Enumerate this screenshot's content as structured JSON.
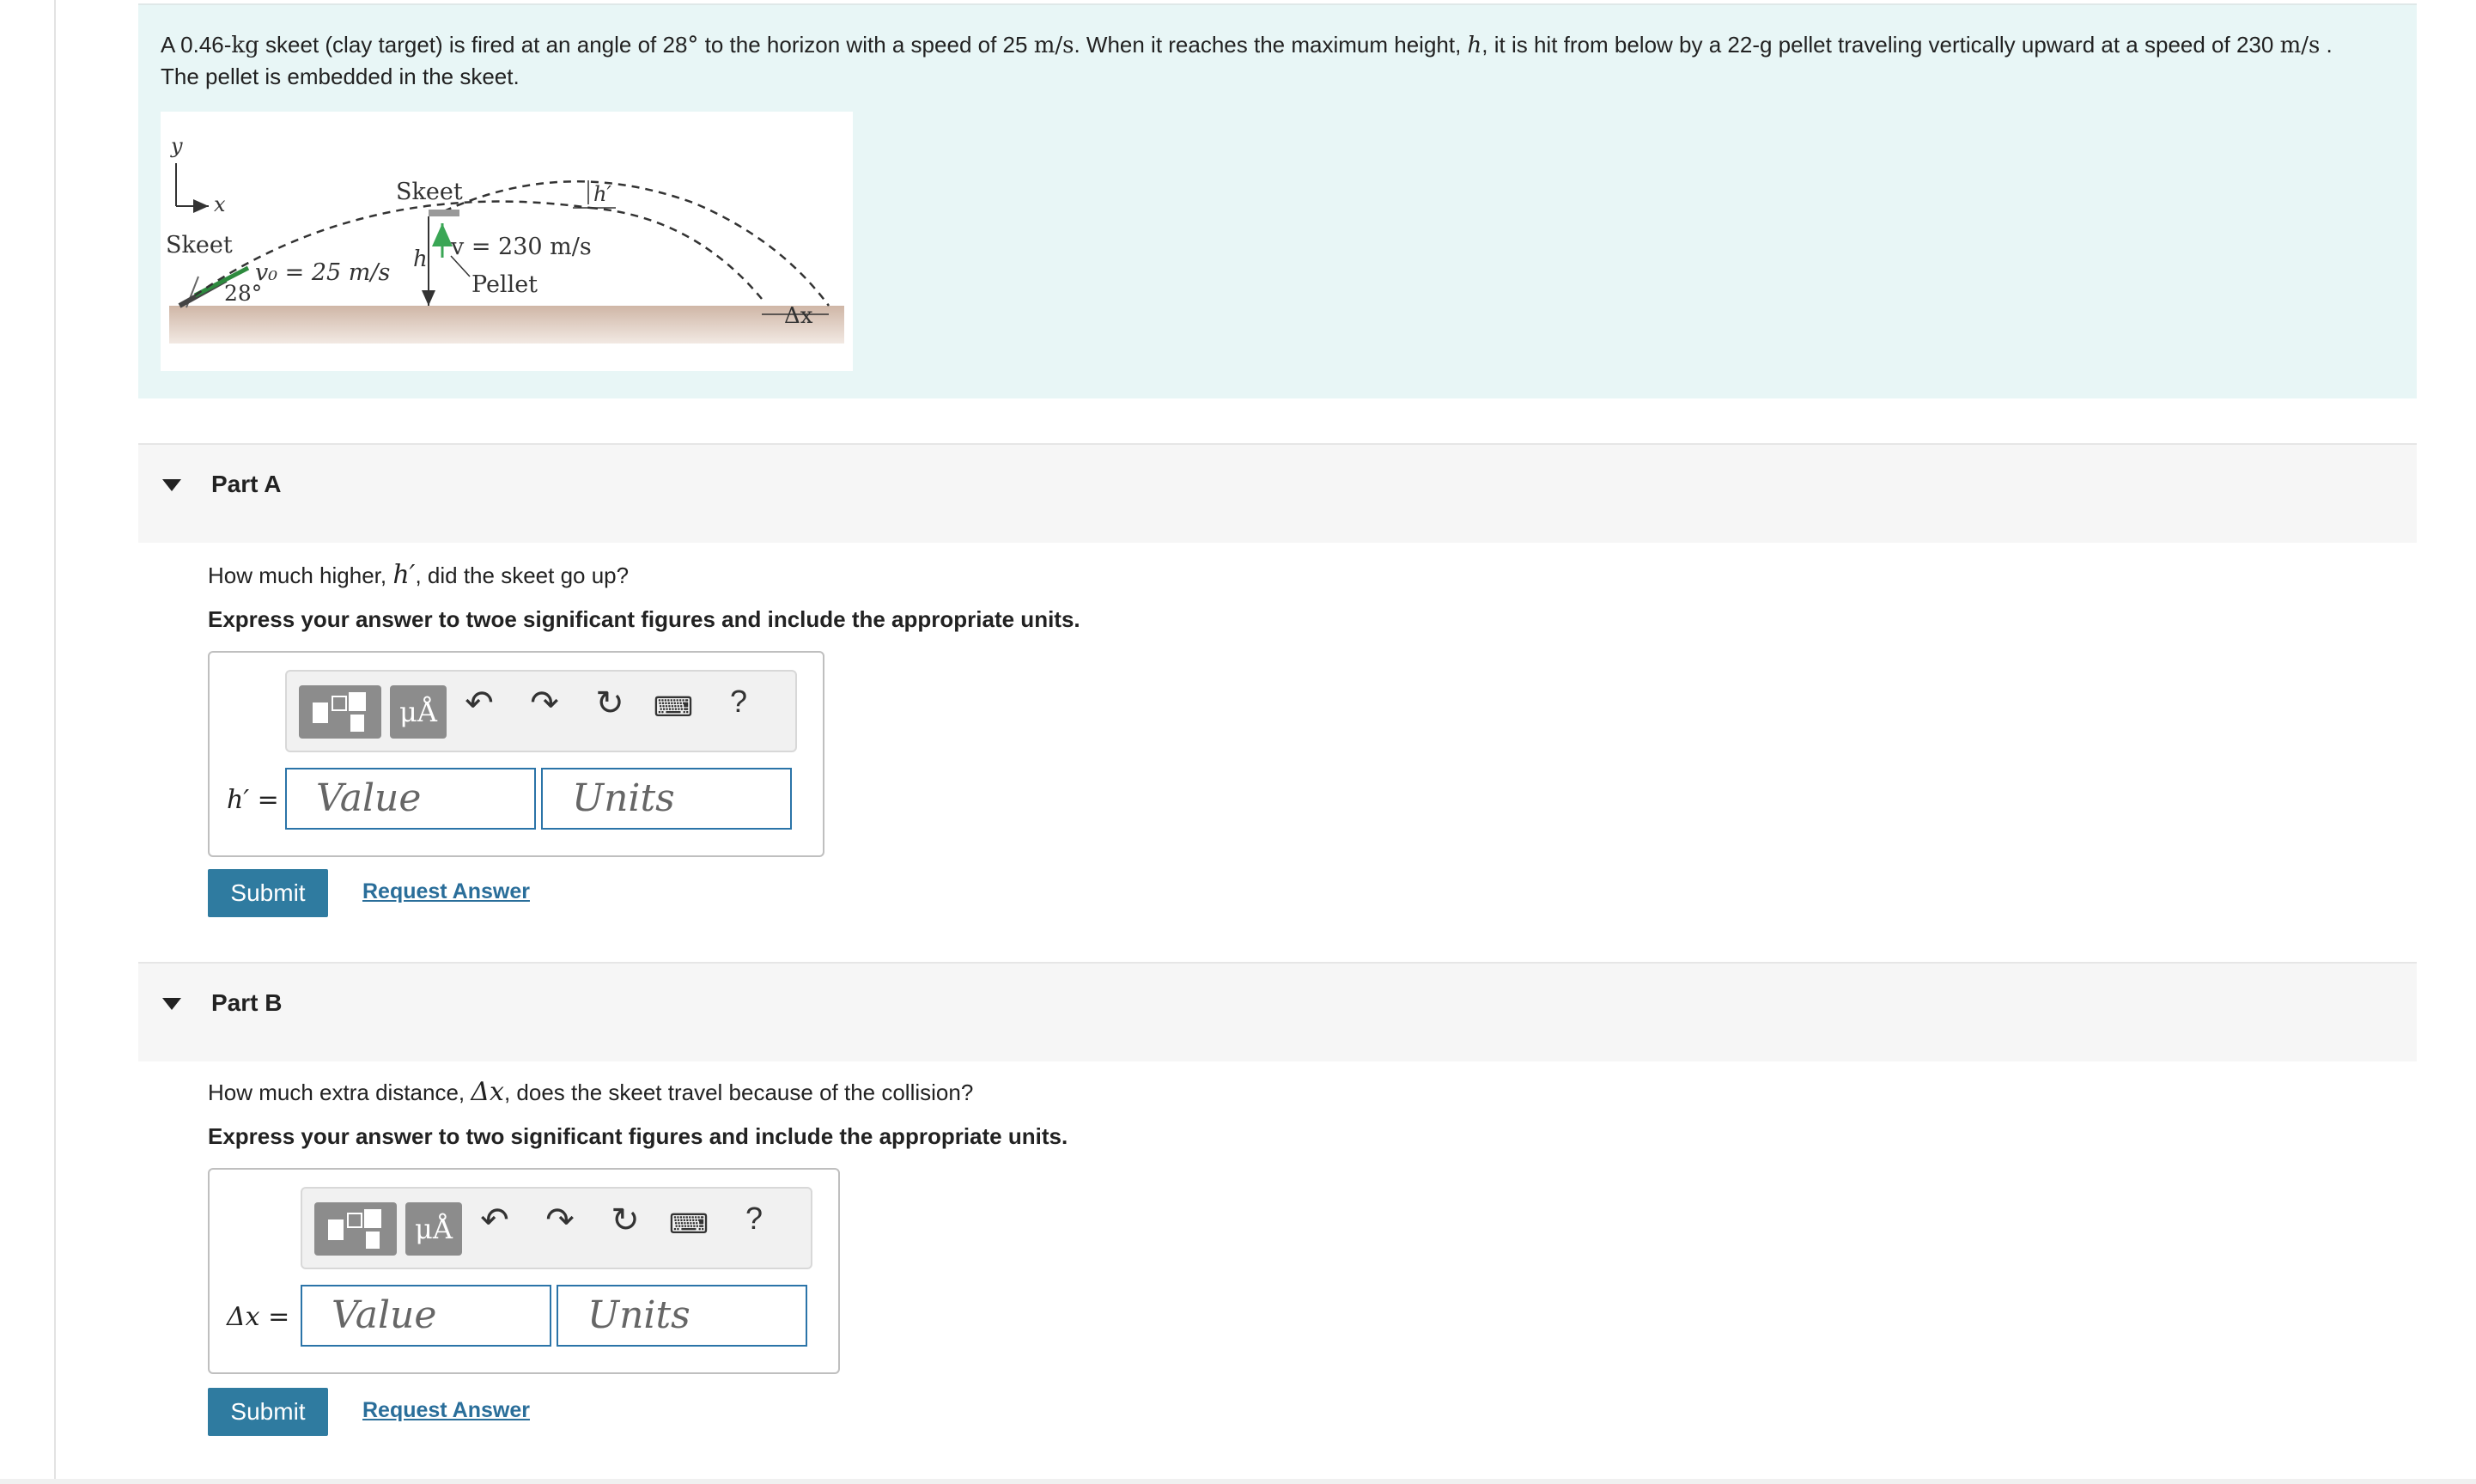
{
  "problem": {
    "text_1": "A 0.46-",
    "kg": "kg",
    "text_2": " skeet (clay target) is fired at an angle of 28",
    "deg": "°",
    "text_3": " to the horizon with a speed of 25 ",
    "ms": "m/s",
    "text_4": ". When it reaches the maximum height, ",
    "h": "h",
    "text_5": ", it is hit from below by a 22-g pellet traveling vertically upward at a speed of 230 ",
    "ms2": "m/s",
    "text_6": " . The pellet is embedded in the skeet."
  },
  "figure": {
    "axis_y": "y",
    "axis_x": "x",
    "skeet_left": "Skeet",
    "skeet_top": "Skeet",
    "v0_label": "v₀ = 25 m/s",
    "angle_label": "28°",
    "h_label": "h",
    "hprime_label": "h′",
    "v_label": "v = 230 m/s",
    "pellet_label": "Pellet",
    "dx_label": "Δx"
  },
  "colors": {
    "accent": "#2f7ba0",
    "field_border": "#2b74a8",
    "problem_bg": "#e8f6f6",
    "link": "#2a6e9a",
    "pellet_arrow": "#3aa655"
  },
  "toolbar_icons": [
    "templates-icon",
    "units-mu-angstrom-icon",
    "undo-icon",
    "redo-icon",
    "reset-icon",
    "keyboard-icon",
    "help-icon"
  ],
  "toolbar_labels": {
    "mu": "μÅ",
    "help": "?"
  },
  "partA": {
    "title": "Part A",
    "q_1": "How much higher, ",
    "q_var": "h′",
    "q_2": ", did the skeet go up?",
    "instruction": "Express your answer to twoe significant figures and include the appropriate units.",
    "eq_label": "h′ =",
    "value_placeholder": "Value",
    "units_placeholder": "Units",
    "submit": "Submit",
    "request": "Request Answer"
  },
  "partB": {
    "title": "Part B",
    "q_1": "How much extra distance, ",
    "q_var": "Δx",
    "q_2": ", does the skeet travel because of the collision?",
    "instruction": "Express your answer to two significant figures and include the appropriate units.",
    "eq_label": "Δx =",
    "value_placeholder": "Value",
    "units_placeholder": "Units",
    "submit": "Submit",
    "request": "Request Answer"
  }
}
